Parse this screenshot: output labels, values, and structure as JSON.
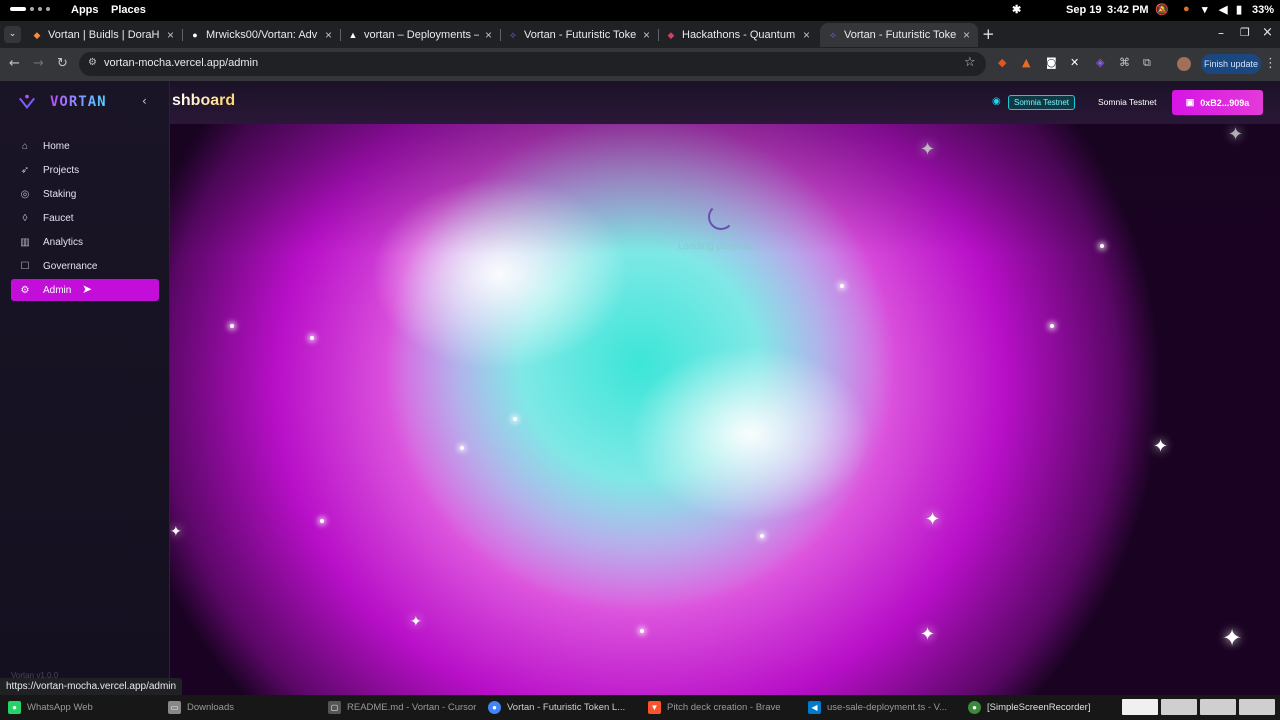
{
  "topbar": {
    "apps": "Apps",
    "places": "Places",
    "date": "Sep 19",
    "time": "3:42 PM",
    "battery": "33%"
  },
  "tabs": [
    {
      "title": "Vortan | Buidls | DoraH",
      "favicon": "dorahacks-icon"
    },
    {
      "title": "Mrwicks00/Vortan: Adv",
      "favicon": "github-icon"
    },
    {
      "title": "vortan – Deployments –",
      "favicon": "vercel-icon"
    },
    {
      "title": "Vortan - Futuristic Toke",
      "favicon": "vortan-icon"
    },
    {
      "title": "Hackathons - Quantum",
      "favicon": "quantum-icon"
    },
    {
      "title": "Vortan - Futuristic Toke",
      "favicon": "vortan-icon",
      "active": true
    }
  ],
  "address_bar": {
    "url": "vortan-mocha.vercel.app/admin",
    "finish_update": "Finish update"
  },
  "app": {
    "brand": "VORTAN",
    "header_title": "shboard",
    "network_badge": "Somnia Testnet",
    "network_button": "Somnia Testnet",
    "wallet": "0xB2...909a",
    "loading": "Loading projects...",
    "version": "Vortan v1.0.0",
    "nav": [
      {
        "label": "Home",
        "icon": "home-icon"
      },
      {
        "label": "Projects",
        "icon": "rocket-icon"
      },
      {
        "label": "Staking",
        "icon": "coins-icon"
      },
      {
        "label": "Faucet",
        "icon": "droplet-icon"
      },
      {
        "label": "Analytics",
        "icon": "bar-chart-icon"
      },
      {
        "label": "Governance",
        "icon": "vote-icon"
      },
      {
        "label": "Admin",
        "icon": "gear-icon",
        "active": true
      }
    ]
  },
  "status_url": "https://vortan-mocha.vercel.app/admin",
  "taskbar": [
    {
      "label": "WhatsApp Web",
      "color": "#25d366"
    },
    {
      "label": "Downloads",
      "color": "#888888"
    },
    {
      "label": "README.md - Vortan - Cursor",
      "color": "#555555"
    },
    {
      "label": "Vortan - Futuristic Token L...",
      "color": "#4285f4"
    },
    {
      "label": "Pitch deck creation - Brave",
      "color": "#fb542b"
    },
    {
      "label": "use-sale-deployment.ts - V...",
      "color": "#007acc"
    },
    {
      "label": "[SimpleScreenRecorder]",
      "color": "#3a8a3a"
    }
  ]
}
